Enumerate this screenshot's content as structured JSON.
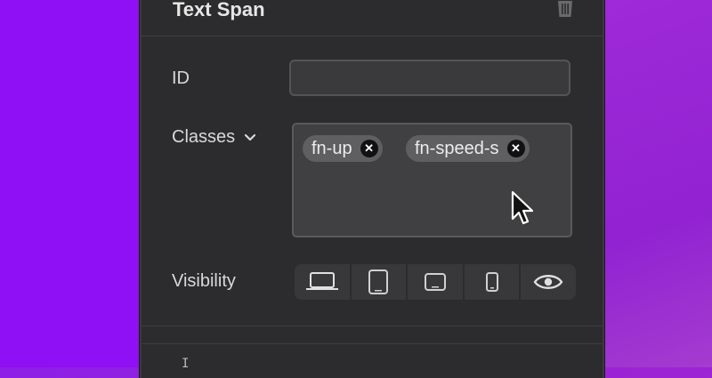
{
  "panel": {
    "title": "Text Span",
    "id_label": "ID",
    "id_value": "",
    "classes_label": "Classes",
    "classes": [
      "fn-up",
      "fn-speed-s"
    ],
    "visibility_label": "Visibility",
    "visibility_options": [
      "laptop-icon",
      "tablet-icon",
      "tablet-landscape-icon",
      "phone-icon",
      "eye-icon"
    ],
    "text_cursor": "I"
  }
}
